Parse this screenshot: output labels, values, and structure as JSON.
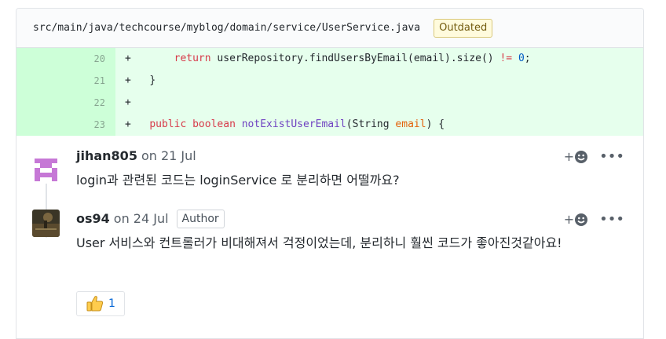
{
  "file": {
    "path": "src/main/java/techcourse/myblog/domain/service/UserService.java",
    "badge": "Outdated"
  },
  "diff": [
    {
      "line": "20",
      "marker": "+"
    },
    {
      "line": "21",
      "marker": "+"
    },
    {
      "line": "22",
      "marker": "+"
    },
    {
      "line": "23",
      "marker": "+"
    }
  ],
  "code": {
    "l20": {
      "kw": "return",
      "a": " userRepository.findUsersByEmail(email).size() ",
      "op": "!=",
      "num": "0",
      "end": ";"
    },
    "l21": {
      "text": "}"
    },
    "l23": {
      "kw1": "public",
      "kw2": "boolean",
      "fn": "notExistUserEmail",
      "a": "(String ",
      "param": "email",
      "end": ") {"
    }
  },
  "comments": [
    {
      "author": "jihan805",
      "date": "on 21 Jul",
      "body": "login과 관련된 코드는 loginService 로 분리하면 어떨까요?"
    },
    {
      "author": "os94",
      "date": "on 24 Jul",
      "badge": "Author",
      "body": "User 서비스와 컨트롤러가 비대해져서 걱정이었는데, 분리하니 훨씬 코드가 좋아진것같아요!"
    }
  ],
  "actions": {
    "react": "+",
    "more": "•••"
  },
  "reaction": {
    "emoji": "thumbs-up-icon",
    "count": "1"
  }
}
